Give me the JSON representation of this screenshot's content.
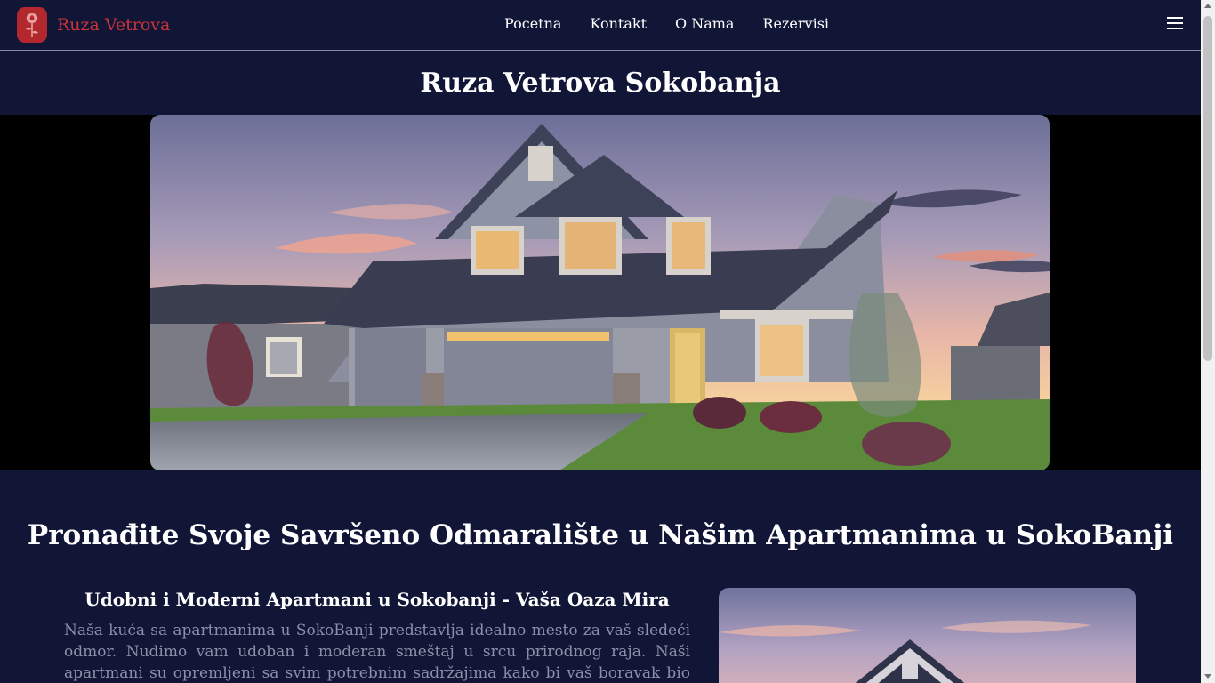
{
  "nav": {
    "brand": "Ruza Vetrova",
    "links": [
      "Pocetna",
      "Kontakt",
      "O Nama",
      "Rezervisi"
    ]
  },
  "hero": {
    "title": "Ruza Vetrova Sokobanja"
  },
  "content": {
    "heading": "Pronađite Svoje Savršeno Odmaralište u Našim Apartmanima u SokoBanji",
    "subheading": "Udobni i Moderni Apartmani u Sokobanji - Vaša Oaza Mira",
    "paragraph": "Naša kuća sa apartmanima u SokoBanji predstavlja idealno mesto za vaš sledeći odmor. Nudimo vam udoban i moderan smeštaj u srcu prirodnog raja. Naši apartmani su opremljeni sa svim potrebnim sadržajima kako bi vaš boravak bio što prijatniji. Svaki"
  },
  "colors": {
    "background": "#111536",
    "brand": "#c8343a",
    "logo_bg": "#b3282d",
    "muted_text": "#8d8fa8"
  },
  "icons": [
    "rose-icon",
    "hamburger-menu-icon"
  ]
}
